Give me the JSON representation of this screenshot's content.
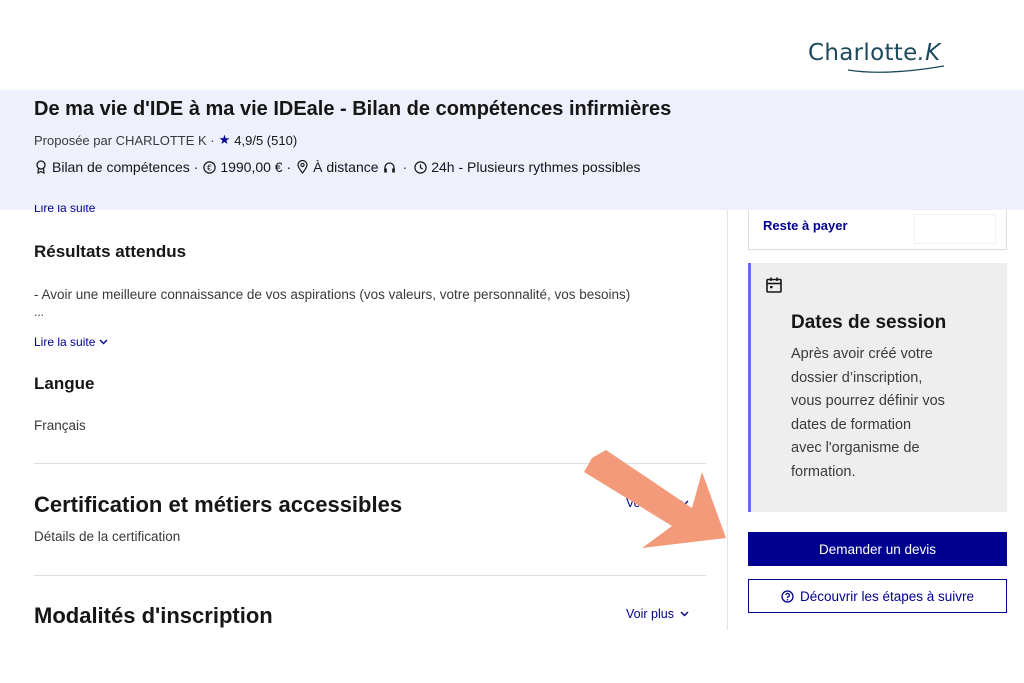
{
  "logo": {
    "text_main": "Charlo",
    "text_mid": "tte",
    "text_end": ".K"
  },
  "header": {
    "title": "De ma vie d'IDE à ma vie IDEale - Bilan de compétences infirmières",
    "proposed_by": "Proposée par CHARLOTTE K ·",
    "rating": "4,9/5 (510)",
    "tags": {
      "type": "Bilan de compétences ·",
      "price": "1990,00 € ·",
      "mode": "À distance",
      "duration": "24h - Plusieurs rythmes possibles"
    }
  },
  "main": {
    "partial_read_more": "Lire la suite",
    "results": {
      "heading": "Résultats attendus",
      "text": "- Avoir une meilleure connaissance de vos aspirations (vos valeurs, votre personnalité, vos besoins)",
      "ellipsis": "...",
      "read_more": "Lire la suite"
    },
    "language": {
      "heading": "Langue",
      "value": "Français"
    },
    "certification": {
      "heading": "Certification et métiers accessibles",
      "sub": "Détails de la certification",
      "voir_plus": "Voir plus"
    },
    "registration": {
      "heading": "Modalités d'inscription",
      "voir_plus": "Voir plus"
    }
  },
  "sidebar": {
    "remaining_label": "Reste à payer",
    "dates": {
      "title": "Dates de session",
      "lines": [
        "Après avoir créé votre",
        "dossier d’inscription,",
        "vous pourrez définir vos",
        "dates de formation",
        "avec l'organisme de",
        "formation."
      ]
    },
    "quote_button": "Demander un devis",
    "steps_button": "Découvrir les étapes à suivre"
  },
  "colors": {
    "primary_blue": "#000091",
    "header_band": "#eef0fb",
    "accent_border": "#6a6af4",
    "arrow": "#f39a7a",
    "logo": "#1d4a5b"
  },
  "icons": {
    "star": "star-icon",
    "badge": "award-icon",
    "euro": "euro-icon",
    "location": "location-pin-icon",
    "headset": "headset-icon",
    "clock": "clock-icon",
    "calendar": "calendar-icon",
    "help": "help-circle-icon",
    "chevron": "chevron-down-icon",
    "arrow": "pointer-arrow-icon"
  }
}
